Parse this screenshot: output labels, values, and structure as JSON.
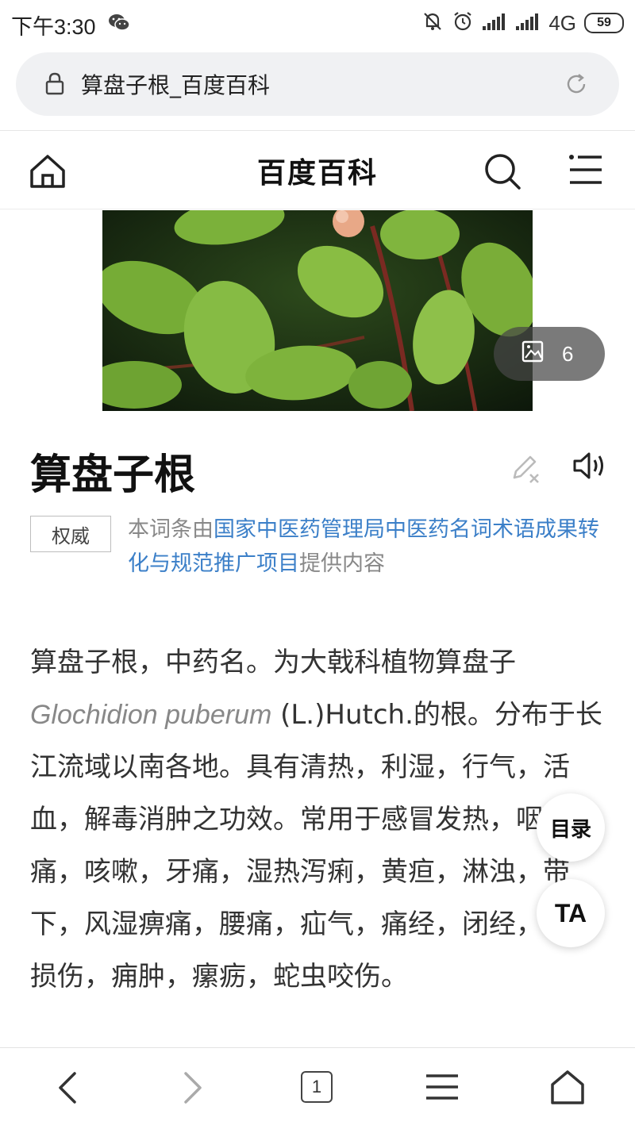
{
  "status_bar": {
    "time": "下午3:30",
    "network": "4G",
    "battery": "59",
    "icons": [
      "wechat-icon",
      "mute-icon",
      "alarm-icon",
      "signal-icon",
      "signal-icon"
    ]
  },
  "address_bar": {
    "url_text": "算盘子根_百度百科",
    "icons": [
      "lock-icon",
      "reload-icon"
    ]
  },
  "header": {
    "title": "百度百科",
    "icons": [
      "home-icon",
      "search-icon",
      "menu-icon"
    ]
  },
  "hero": {
    "photo_count": "6",
    "icons": [
      "gallery-icon"
    ]
  },
  "entry": {
    "title": "算盘子根",
    "authority_tag": "权威",
    "authority_prefix": "本词条由",
    "authority_link": "国家中医药管理局中医药名词术语成果转化与规范推广项目",
    "authority_suffix": "提供内容",
    "summary_part1": "算盘子根，中药名。为大戟科植物算盘子",
    "summary_latin": "Glochidion puberum",
    "summary_part2": " (L.)Hutch.的根。分布于长江流域以南各地。具有清热，利湿，行气，活血，解毒消肿之功效。常用于感冒发热，咽喉肿痛，咳嗽，牙痛，湿热泻痢，黄疸，淋浊，带下，风湿痹痛，腰痛，疝气，痛经，闭经，跌打损伤，痈肿，瘰疬，蛇虫咬伤。"
  },
  "floating": {
    "toc_label": "目录",
    "font_label": "TA"
  },
  "bottom_nav": {
    "tab_count": "1",
    "icons": [
      "back-icon",
      "forward-icon",
      "tabs-icon",
      "menu-icon",
      "home-icon"
    ]
  },
  "colors": {
    "link": "#3b7fc8",
    "leaf_green": "#6aa52e",
    "badge_bg": "#464646"
  }
}
